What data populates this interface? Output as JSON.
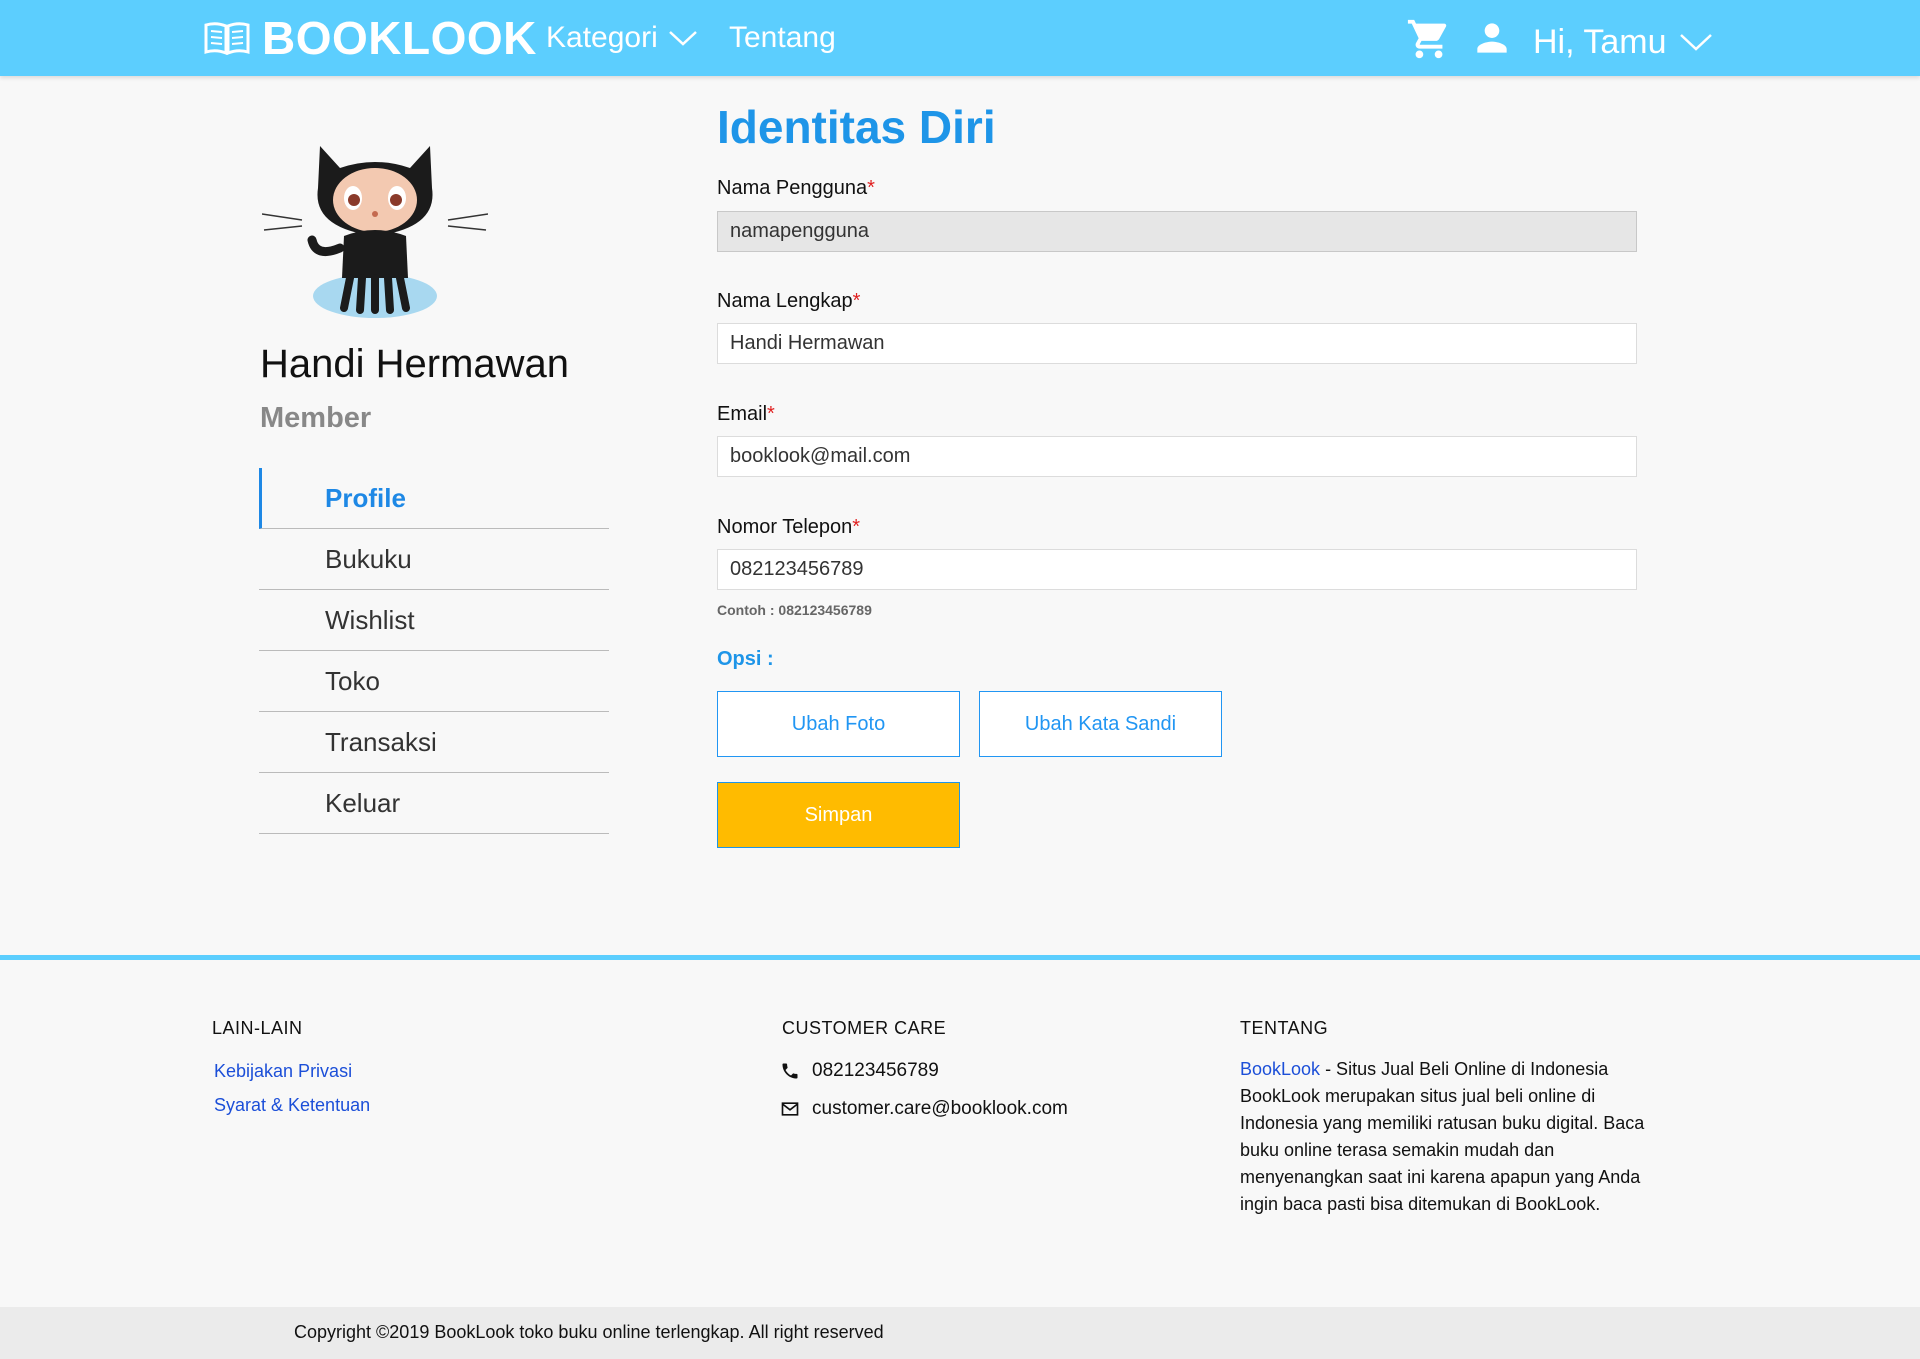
{
  "navbar": {
    "brand": "BOOKLOOK",
    "kategori": "Kategori",
    "tentang": "Tentang",
    "greeting": "Hi, Tamu",
    "icons": [
      "book-icon",
      "chevron-down-icon",
      "cart-icon",
      "user-icon"
    ]
  },
  "profile": {
    "name": "Handi Hermawan",
    "role": "Member",
    "menu": [
      "Profile",
      "Bukuku",
      "Wishlist",
      "Toko",
      "Transaksi",
      "Keluar"
    ],
    "active_menu": "Profile"
  },
  "form": {
    "title": "Identitas Diri",
    "username_label": "Nama Pengguna",
    "username_value": "namapengguna",
    "fullname_label": "Nama Lengkap",
    "fullname_value": "Handi Hermawan",
    "email_label": "Email",
    "email_value": "booklook@mail.com",
    "phone_label": "Nomor Telepon",
    "phone_value": "082123456789",
    "phone_hint": "Contoh : 082123456789",
    "required_mark": "*",
    "options_label": "Opsi :",
    "change_photo": "Ubah Foto",
    "change_password": "Ubah Kata Sandi",
    "save": "Simpan"
  },
  "footer": {
    "lain_heading": "LAIN-LAIN",
    "privacy": "Kebijakan Privasi",
    "terms": "Syarat & Ketentuan",
    "care_heading": "CUSTOMER CARE",
    "care_phone": "082123456789",
    "care_email": "customer.care@booklook.com",
    "tentang_heading": "TENTANG",
    "about_brand": "BookLook",
    "about_text": " - Situs Jual Beli Online di Indonesia BookLook merupakan situs jual beli online di Indonesia yang memiliki ratusan buku digital. Baca buku online terasa semakin mudah dan menyenangkan saat ini karena apapun yang Anda ingin baca pasti bisa ditemukan di BookLook.",
    "copyright": "Copyright ©2019 BookLook toko buku online terlengkap. All right reserved"
  },
  "colors": {
    "navbar": "#5ccefe",
    "accent_blue": "#1e95e8",
    "link_blue": "#1c4fd8",
    "save_button": "#ffbb00",
    "required": "#e02020"
  }
}
